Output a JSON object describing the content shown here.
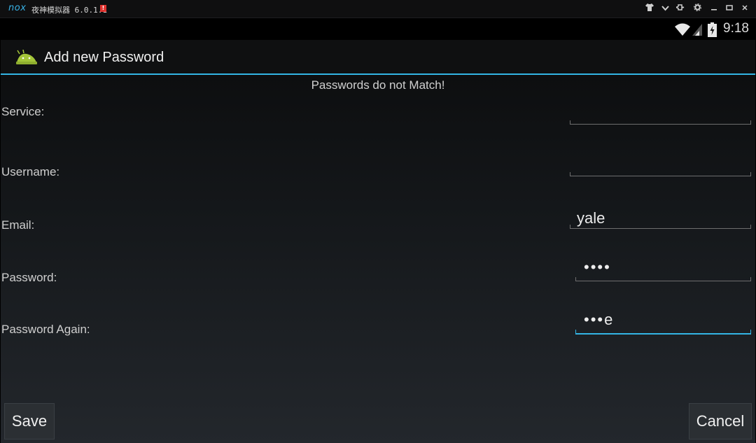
{
  "emulator": {
    "logo": "nox",
    "title": "夜神模拟器 6.0.1.1",
    "badge": "!",
    "controls": [
      "shirt-icon",
      "chevron-down-icon",
      "pin-icon",
      "gear-icon",
      "minimize-icon",
      "maximize-icon",
      "close-icon"
    ]
  },
  "status_bar": {
    "time": "9:18"
  },
  "action_bar": {
    "title": "Add new Password"
  },
  "form": {
    "message": "Passwords do not Match!",
    "fields": [
      {
        "label": "Service:",
        "value": ""
      },
      {
        "label": "Username:",
        "value": ""
      },
      {
        "label": "Email:",
        "value": "yale"
      },
      {
        "label": "Password:",
        "value": "••••"
      },
      {
        "label": "Password Again:",
        "value": "•••e"
      }
    ]
  },
  "buttons": {
    "save": "Save",
    "cancel": "Cancel"
  },
  "colors": {
    "accent": "#33b5e5",
    "error_badge": "#e0332f"
  }
}
